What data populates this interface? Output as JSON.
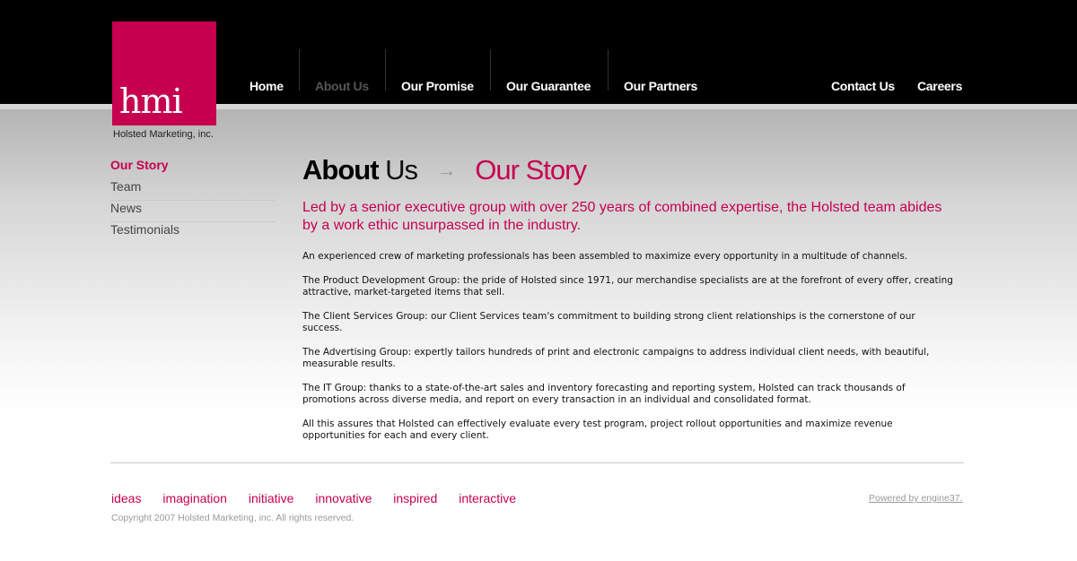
{
  "logo": {
    "text": "hmi",
    "tagline": "Holsted Marketing, inc."
  },
  "nav": {
    "items": [
      {
        "label": "Home"
      },
      {
        "label": "About Us"
      },
      {
        "label": "Our Promise"
      },
      {
        "label": "Our Guarantee"
      },
      {
        "label": "Our Partners"
      },
      {
        "label": "Contact Us"
      },
      {
        "label": "Careers"
      }
    ],
    "active": "About Us"
  },
  "sidebar": {
    "items": [
      {
        "label": "Our Story"
      },
      {
        "label": "Team"
      },
      {
        "label": "News"
      },
      {
        "label": "Testimonials"
      }
    ]
  },
  "main": {
    "title_bold": "About",
    "title_normal": "Us",
    "title_arrow": "→",
    "title_page": "Our Story",
    "intro": "Led by a senior executive group with over 250 years of combined expertise, the Holsted team abides by a work ethic unsurpassed in the industry.",
    "paragraphs": [
      "An experienced crew of marketing professionals has been assembled to maximize every opportunity in a multitude of channels.",
      "The Product Development Group: the pride of Holsted since 1971, our merchandise specialists are at the forefront of every offer, creating attractive, market-targeted items that sell.",
      "The Client Services Group: our Client Services team's commitment to building strong client relationships is the cornerstone of our success.",
      "The Advertising Group: expertly tailors hundreds of print and electronic campaigns to address individual client needs, with beautiful, measurable results.",
      "The IT Group: thanks to a state-of-the-art sales and inventory forecasting and reporting system, Holsted can track thousands of promotions across diverse media, and report on every transaction in an individual and consolidated format.",
      "All this assures that Holsted can effectively evaluate every test program, project rollout opportunities and maximize revenue opportunities for each and every client."
    ]
  },
  "footer": {
    "words": [
      "ideas",
      "imagination",
      "initiative",
      "innovative",
      "inspired",
      "interactive"
    ],
    "copyright": "Copyright 2007 Holsted Marketing, inc. All rights reserved.",
    "powered": "Powered by engine37."
  },
  "colors": {
    "accent": "#c6004f",
    "topbar": "#000000"
  }
}
